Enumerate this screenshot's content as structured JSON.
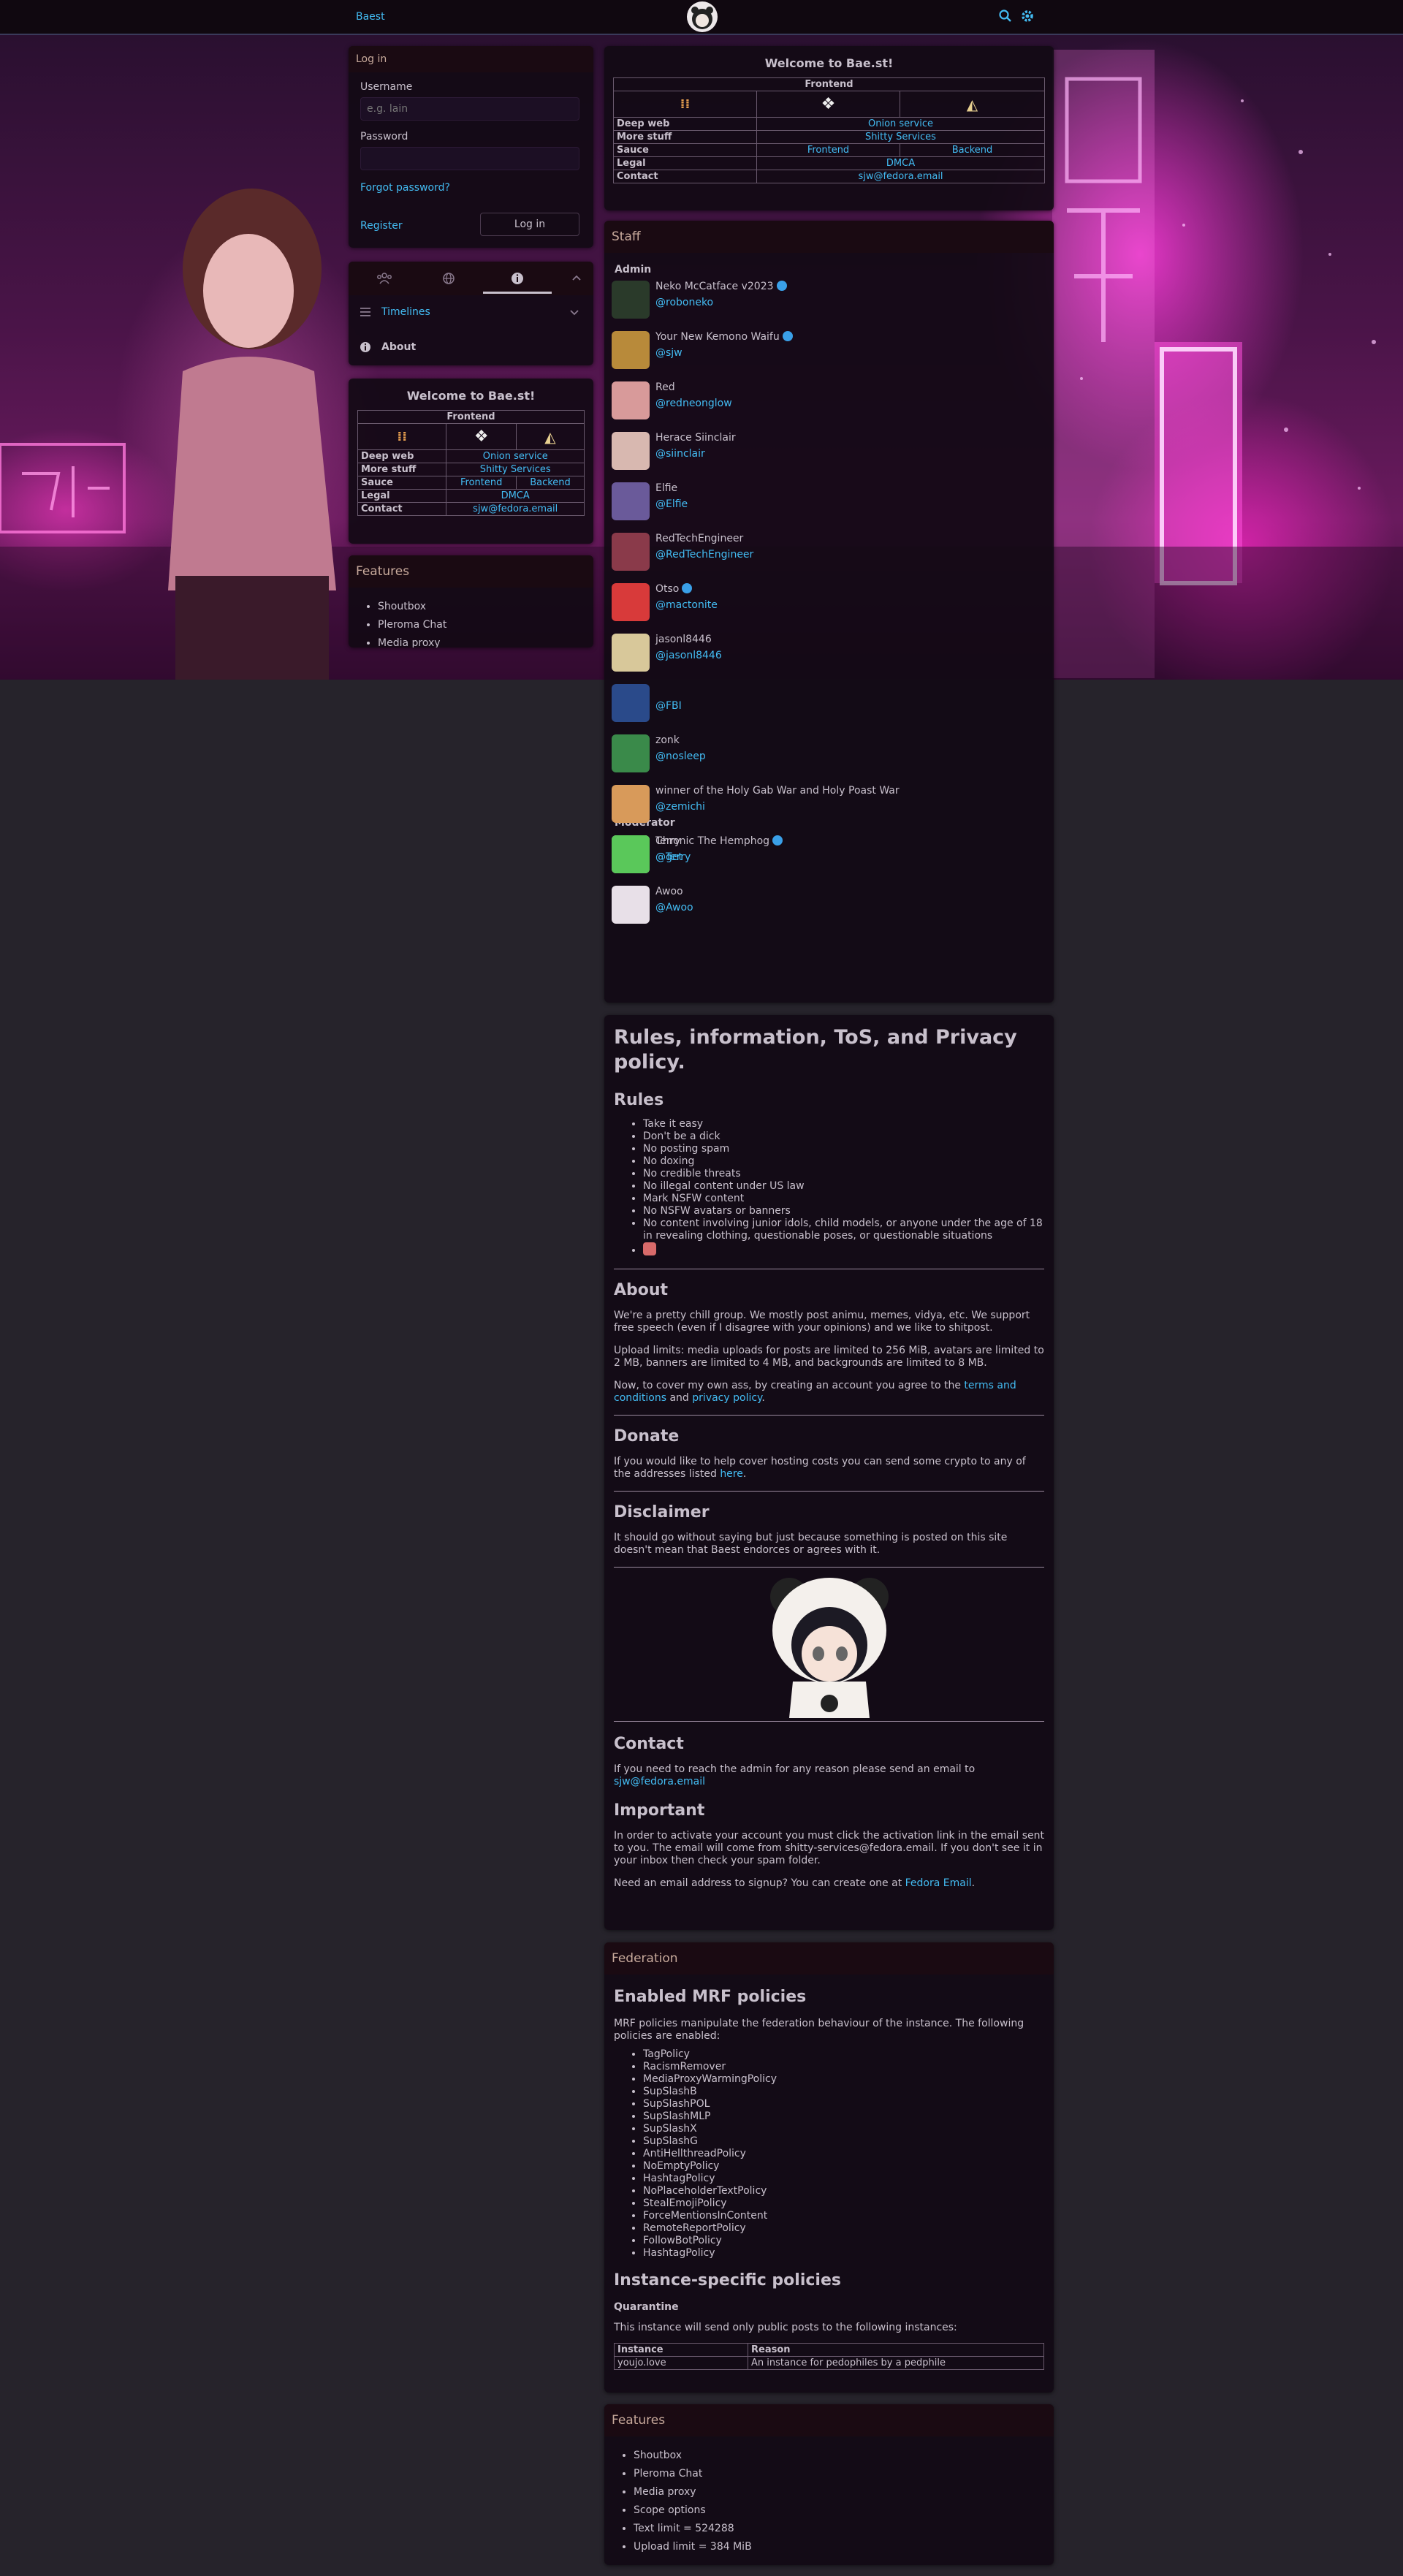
{
  "topbar": {
    "brand": "Baest"
  },
  "login": {
    "heading": "Log in",
    "username_label": "Username",
    "username_placeholder": "e.g. lain",
    "password_label": "Password",
    "forgot": "Forgot password?",
    "register": "Register",
    "login_button": "Log in"
  },
  "nav": {
    "timelines": "Timelines",
    "about": "About"
  },
  "welcome": {
    "title": "Welcome to Bae.st!",
    "frontend_header": "Frontend",
    "rows": [
      {
        "key": "Deep web",
        "value": "Onion service"
      },
      {
        "key": "More stuff",
        "value": "Shitty Services"
      },
      {
        "key": "Sauce",
        "value_a": "Frontend",
        "value_b": "Backend"
      },
      {
        "key": "Legal",
        "value": "DMCA"
      },
      {
        "key": "Contact",
        "value": "sjw@fedora.email"
      }
    ]
  },
  "left_features": {
    "heading": "Features",
    "items": [
      "Shoutbox",
      "Pleroma Chat",
      "Media proxy"
    ]
  },
  "staff": {
    "heading": "Staff",
    "admin_label": "Admin",
    "moderator_label": "Moderator",
    "admins": [
      {
        "name": "Neko McCatface v2023",
        "handle": "@roboneko",
        "color": "#2a3a2a"
      },
      {
        "name": "Your New Kemono Waifu",
        "handle": "@sjw",
        "color": "#b88a3a"
      },
      {
        "name": "Red",
        "handle": "@redneonglow",
        "color": "#d89a9a"
      },
      {
        "name": "Herace Siinclair",
        "handle": "@siinclair",
        "color": "#d8b8b0"
      },
      {
        "name": "Elfie",
        "handle": "@Elfie",
        "color": "#6a5a9a"
      },
      {
        "name": "RedTechEngineer",
        "handle": "@RedTechEngineer",
        "color": "#8a3a4a"
      },
      {
        "name": "Otso",
        "handle": "@mactonite",
        "color": "#d83a3a"
      },
      {
        "name": "jasonl8446",
        "handle": "@jasonl8446",
        "color": "#d8c89a"
      },
      {
        "name": "",
        "handle": "@FBI",
        "color": "#2a4a8a"
      },
      {
        "name": "zonk",
        "handle": "@nosleep",
        "color": "#3a8a4a"
      },
      {
        "name": "winner of the Holy Gab War and Holy Poast War",
        "handle": "@zemichi",
        "color": "#d89a5a"
      },
      {
        "name": "Terry",
        "handle": "@Terry",
        "color": "#d8d0c8"
      }
    ],
    "moderators": [
      {
        "name": "Chronic The Hemphog",
        "handle": "@get",
        "color": "#5ac85a"
      },
      {
        "name": "Awoo",
        "handle": "@Awoo",
        "color": "#e8e0e8"
      }
    ]
  },
  "rules": {
    "title": "Rules, information, ToS, and Privacy policy.",
    "rules_heading": "Rules",
    "rules_list": [
      "Take it easy",
      "Don't be a dick",
      "No posting spam",
      "No doxing",
      "No credible threats",
      "No illegal content under US law",
      "Mark NSFW content",
      "No NSFW avatars or banners",
      "No content involving junior idols, child models, or anyone under the age of 18 in revealing clothing, questionable poses, or questionable situations"
    ],
    "about_heading": "About",
    "about_p1": "We're a pretty chill group. We mostly post animu, memes, vidya, etc. We support free speech (even if I disagree with your opinions) and we like to shitpost.",
    "about_p2": "Upload limits: media uploads for posts are limited to 256 MiB, avatars are limited to 2 MB, banners are limited to 4 MB, and backgrounds are limited to 8 MB.",
    "about_p3_a": "Now, to cover my own ass, by creating an account you agree to the ",
    "about_p3_terms": "terms and conditions",
    "about_p3_and": " and ",
    "about_p3_privacy": "privacy policy",
    "about_p3_end": ".",
    "donate_heading": "Donate",
    "donate_p_a": "If you would like to help cover hosting costs you can send some crypto to any of the addresses listed ",
    "donate_link": "here",
    "donate_p_end": ".",
    "disclaimer_heading": "Disclaimer",
    "disclaimer_p": "It should go without saying but just because something is posted on this site doesn't mean that Baest endorces or agrees with it.",
    "contact_heading": "Contact",
    "contact_p": "If you need to reach the admin for any reason please send an email to",
    "contact_email": "sjw@fedora.email",
    "important_heading": "Important",
    "important_p1": "In order to activate your account you must click the activation link in the email sent to you. The email will come from shitty-services@fedora.email. If you don't see it in your inbox then check your spam folder.",
    "important_p2_a": "Need an email address to signup? You can create one at ",
    "important_p2_link": "Fedora Email",
    "important_p2_end": "."
  },
  "federation": {
    "heading": "Federation",
    "mrf_title": "Enabled MRF policies",
    "mrf_desc": "MRF policies manipulate the federation behaviour of the instance. The following policies are enabled:",
    "policies": [
      "TagPolicy",
      "RacismRemover",
      "MediaProxyWarmingPolicy",
      "SupSlashB",
      "SupSlashPOL",
      "SupSlashMLP",
      "SupSlashX",
      "SupSlashG",
      "AntiHellthreadPolicy",
      "NoEmptyPolicy",
      "HashtagPolicy",
      "NoPlaceholderTextPolicy",
      "StealEmojiPolicy",
      "ForceMentionsInContent",
      "RemoteReportPolicy",
      "FollowBotPolicy",
      "HashtagPolicy"
    ],
    "instance_title": "Instance-specific policies",
    "quarantine": "Quarantine",
    "quarantine_desc": "This instance will send only public posts to the following instances:",
    "col_instance": "Instance",
    "col_reason": "Reason",
    "row_instance": "youjo.love",
    "row_reason": "An instance for pedophiles by a pedphile"
  },
  "features": {
    "heading": "Features",
    "items": [
      "Shoutbox",
      "Pleroma Chat",
      "Media proxy",
      "Scope options",
      "Text limit = 524288",
      "Upload limit = 384 MiB"
    ]
  },
  "colors": {
    "link": "#43bcf3",
    "panel_bg": "#120a14",
    "heading_bg": "#1a0a12",
    "heading_text": "#c8aa9c",
    "page_bg": "#26232b"
  }
}
